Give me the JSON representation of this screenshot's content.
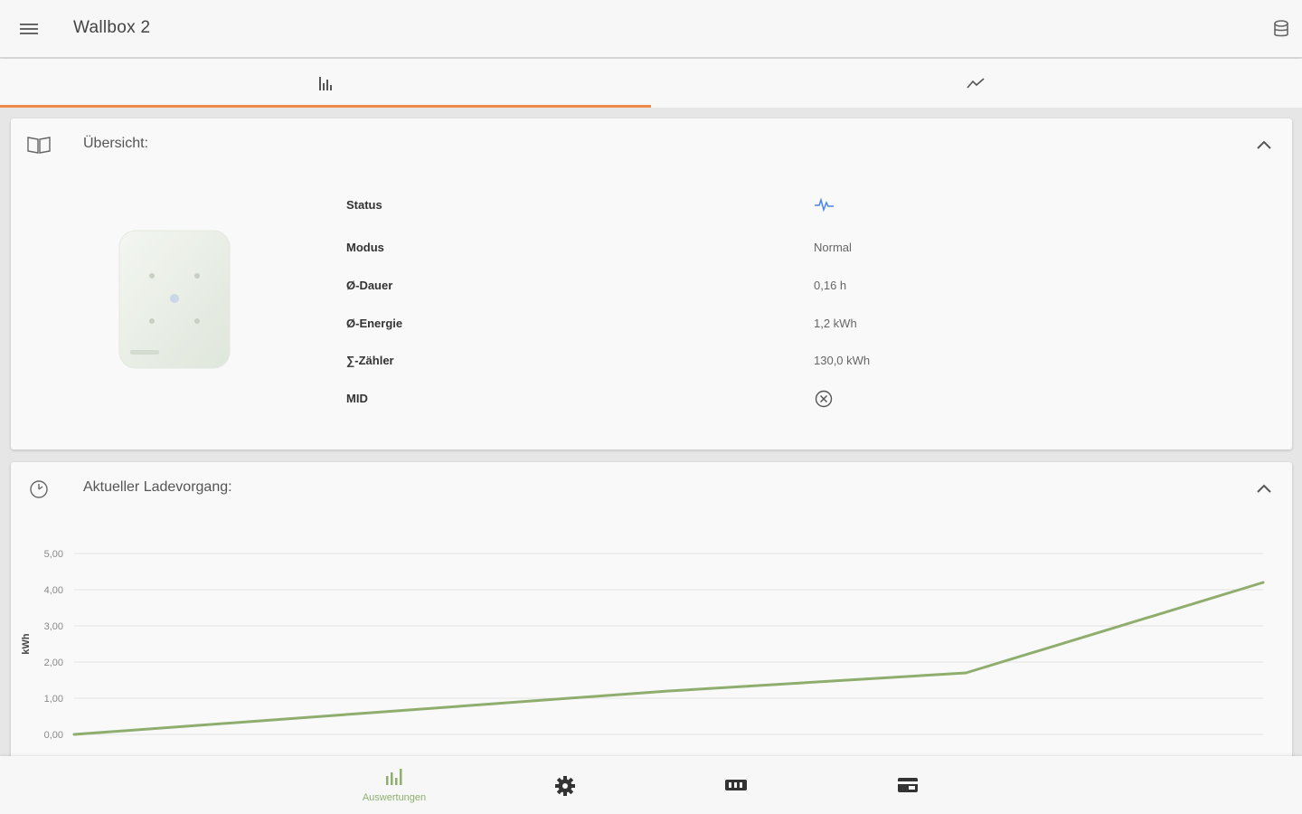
{
  "header": {
    "title": "Wallbox 2"
  },
  "tabs": [
    {
      "icon": "bar-chart-icon",
      "active": true
    },
    {
      "icon": "line-chart-icon",
      "active": false
    }
  ],
  "accent_color": "#f08a4b",
  "overview": {
    "title": "Übersicht:",
    "rows": [
      {
        "label": "Status",
        "value": ""
      },
      {
        "label": "Modus",
        "value": "Normal"
      },
      {
        "label": "Ø-Dauer",
        "value": "0,16 h"
      },
      {
        "label": "Ø-Energie",
        "value": "1,2 kWh"
      },
      {
        "label": "∑-Zähler",
        "value": "130,0 kWh"
      },
      {
        "label": "MID",
        "value": ""
      }
    ],
    "status_icon": "pulse-icon",
    "mid_icon": "close-circle-icon"
  },
  "charging": {
    "title": "Aktueller Ladevorgang:"
  },
  "chart_data": {
    "type": "line",
    "ylabel": "kWh",
    "ylim": [
      0,
      5
    ],
    "y_ticks": [
      "5,00",
      "4,00",
      "3,00",
      "2,00",
      "1,00",
      "0,00"
    ],
    "series": [
      {
        "values": [
          0.0,
          0.6,
          1.2,
          1.7,
          4.2
        ],
        "color": "#8fae6e"
      }
    ],
    "grid": true
  },
  "bottom_nav": [
    {
      "icon": "bar-chart-icon",
      "label": "Auswertungen",
      "active": true
    },
    {
      "icon": "gear-icon",
      "label": ""
    },
    {
      "icon": "overview-icon",
      "label": ""
    },
    {
      "icon": "card-icon",
      "label": ""
    }
  ]
}
